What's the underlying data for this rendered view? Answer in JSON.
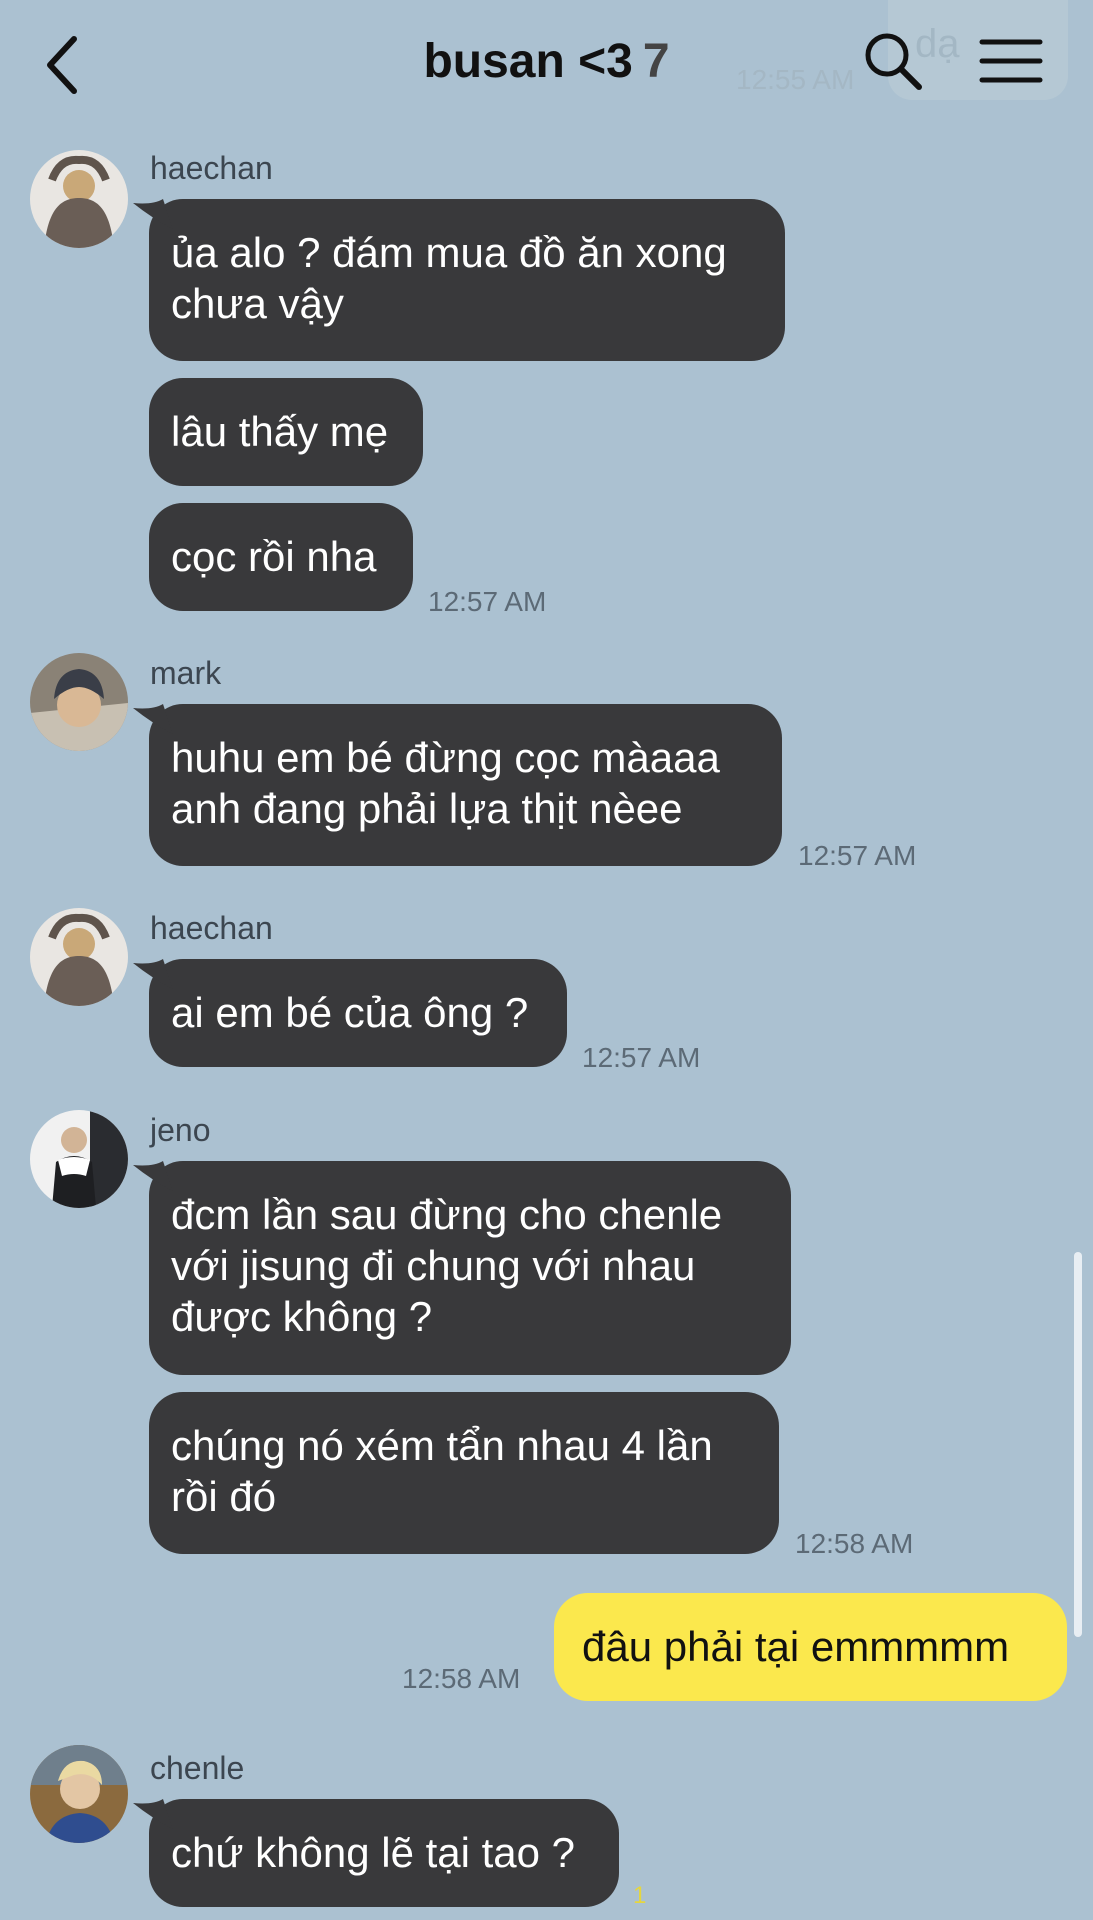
{
  "header": {
    "title": "busan <3",
    "member_count": "7",
    "ghost_preview": "dạ",
    "ghost_time": "12:55 AM",
    "icons": [
      "back-chevron-icon",
      "search-icon",
      "menu-icon"
    ]
  },
  "messages": {
    "haechan1": {
      "sender": "haechan",
      "b1": "ủa alo ? đám mua đồ ăn xong\nchưa vậy",
      "b2": "lâu thấy mẹ",
      "b3": "cọc rồi nha",
      "time": "12:57 AM"
    },
    "mark": {
      "sender": "mark",
      "b1": "huhu em bé đừng cọc màaaa\nanh đang phải lựa thịt nèee",
      "time": "12:57 AM"
    },
    "haechan2": {
      "sender": "haechan",
      "b1": "ai em bé của ông ?",
      "time": "12:57 AM"
    },
    "jeno": {
      "sender": "jeno",
      "b1": "đcm lần sau đừng cho chenle\nvới jisung đi chung với nhau\nđược không ?",
      "b2": "chúng nó xém tẩn nhau 4 lần\nrồi đó",
      "time": "12:58 AM"
    },
    "me": {
      "text": "đâu phải tại emmmmm",
      "time": "12:58 AM"
    },
    "chenle": {
      "sender": "chenle",
      "b1": "chứ không lẽ tại tao ?",
      "unread": "1"
    }
  },
  "colors": {
    "background": "#abc1d1",
    "bubble_other": "#39393b",
    "bubble_me": "#fbe84d"
  }
}
